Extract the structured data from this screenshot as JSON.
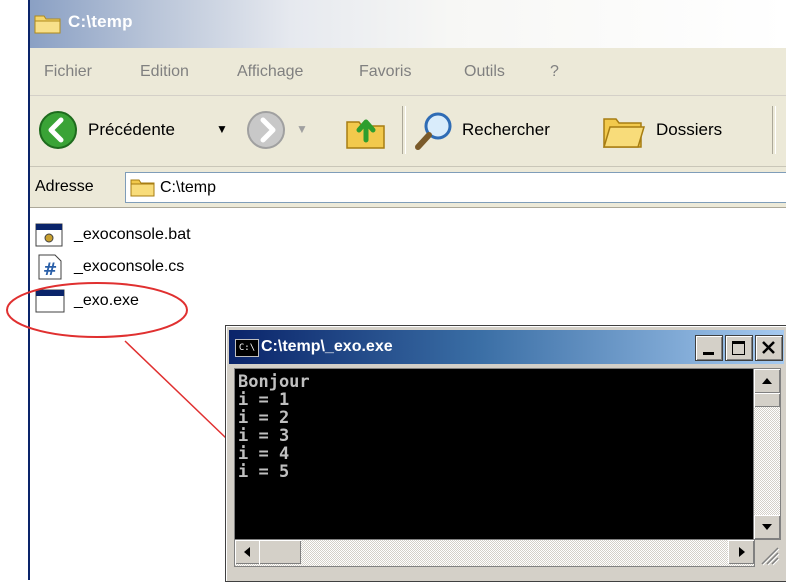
{
  "explorer": {
    "title": "C:\\temp",
    "menu": [
      "Fichier",
      "Edition",
      "Affichage",
      "Favoris",
      "Outils",
      "?"
    ],
    "toolbar": {
      "back_label": "Précédente",
      "search_label": "Rechercher",
      "folders_label": "Dossiers"
    },
    "address": {
      "label": "Adresse",
      "value": "C:\\temp"
    },
    "files": [
      {
        "name": "_exoconsole.bat",
        "icon": "batch-file-icon"
      },
      {
        "name": "_exoconsole.cs",
        "icon": "csharp-file-icon"
      },
      {
        "name": "_exo.exe",
        "icon": "executable-file-icon"
      }
    ]
  },
  "console": {
    "title": "C:\\temp\\_exo.exe",
    "icon_text": "C:\\",
    "lines": [
      "Bonjour",
      "i = 1",
      "i = 2",
      "i = 3",
      "i = 4",
      "i = 5"
    ]
  },
  "colors": {
    "highlight_circle": "#e03030",
    "console_background": "#000000",
    "console_text": "#c0c0c0",
    "console_titlebar": "#0a246a",
    "window_chrome": "#ece9d8"
  }
}
